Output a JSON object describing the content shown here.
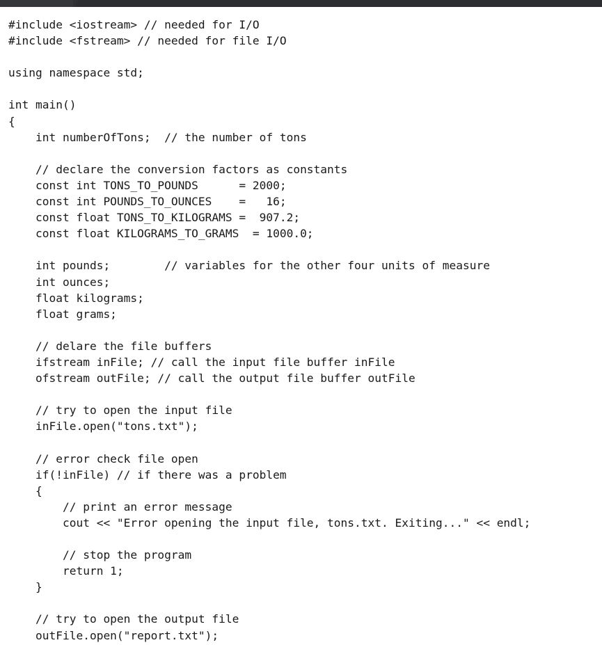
{
  "window": {
    "titlebar_color": "#35373b",
    "titlebar_tab_color": "#2b2d31",
    "background_color": "#ffffff",
    "text_color": "#1a1a1a"
  },
  "document": {
    "language": "C++",
    "code_lines": [
      "#include <iostream> // needed for I/O",
      "#include <fstream> // needed for file I/O",
      "",
      "using namespace std;",
      "",
      "int main()",
      "{",
      "    int numberOfTons;  // the number of tons",
      "",
      "    // declare the conversion factors as constants",
      "    const int TONS_TO_POUNDS      = 2000;",
      "    const int POUNDS_TO_OUNCES    =   16;",
      "    const float TONS_TO_KILOGRAMS =  907.2;",
      "    const float KILOGRAMS_TO_GRAMS  = 1000.0;",
      "",
      "    int pounds;        // variables for the other four units of measure",
      "    int ounces;",
      "    float kilograms;",
      "    float grams;",
      "",
      "    // delare the file buffers",
      "    ifstream inFile; // call the input file buffer inFile",
      "    ofstream outFile; // call the output file buffer outFile",
      "",
      "    // try to open the input file",
      "    inFile.open(\"tons.txt\");",
      "",
      "    // error check file open",
      "    if(!inFile) // if there was a problem",
      "    {",
      "        // print an error message",
      "        cout << \"Error opening the input file, tons.txt. Exiting...\" << endl;",
      "",
      "        // stop the program",
      "        return 1;",
      "    }",
      "",
      "    // try to open the output file",
      "    outFile.open(\"report.txt\");"
    ]
  }
}
